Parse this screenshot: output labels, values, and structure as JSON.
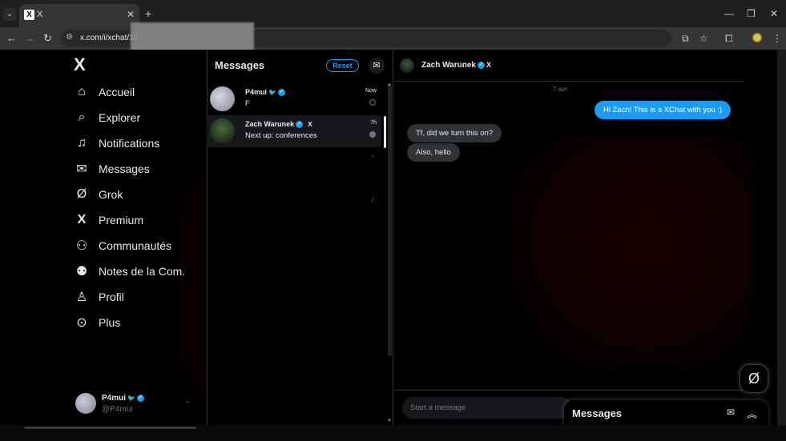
{
  "browser": {
    "tab_title": "X",
    "tab_favicon": "X",
    "url": "x.com/i/xchat/14",
    "menu_icon": "chevron-down-icon",
    "new_tab_icon": "plus-icon"
  },
  "sidebar": {
    "logo": "X",
    "items": [
      {
        "label": "Accueil",
        "icon": "home-icon",
        "glyph": "⌂"
      },
      {
        "label": "Explorer",
        "icon": "search-icon",
        "glyph": "⌕"
      },
      {
        "label": "Notifications",
        "icon": "bell-icon",
        "glyph": "🔔"
      },
      {
        "label": "Messages",
        "icon": "envelope-icon",
        "glyph": "✉"
      },
      {
        "label": "Grok",
        "icon": "grok-icon",
        "glyph": "Ø"
      },
      {
        "label": "Premium",
        "icon": "x-premium-icon",
        "glyph": "X"
      },
      {
        "label": "Communautés",
        "icon": "communities-icon",
        "glyph": "👥"
      },
      {
        "label": "Notes de la Com.",
        "icon": "community-notes-icon",
        "glyph": "👥"
      },
      {
        "label": "Profil",
        "icon": "profile-icon",
        "glyph": "👤"
      },
      {
        "label": "Plus",
        "icon": "more-circle-icon",
        "glyph": "⋯"
      }
    ],
    "account": {
      "name": "P4mui",
      "handle": "@P4mui"
    }
  },
  "messages": {
    "title": "Messages",
    "reset_label": "Reset",
    "conversations": [
      {
        "name": "P4mui",
        "preview": "F",
        "time": "Now",
        "active": false
      },
      {
        "name": "Zach Warunek",
        "preview": "Next up: conferences",
        "time": "7h",
        "active": true
      }
    ]
  },
  "chat": {
    "contact_name": "Zach Warunek",
    "contact_badge": "X",
    "date_separator": "7 avr.",
    "messages": [
      {
        "direction": "out",
        "text": "Hi Zach! This is a XChat with you :)"
      },
      {
        "direction": "in",
        "text": "Tf, did we turn this on?"
      },
      {
        "direction": "in",
        "text": "Also, hello"
      }
    ],
    "composer_placeholder": "Start a message"
  },
  "drawer": {
    "title": "Messages"
  },
  "colors": {
    "accent": "#1d9bf0",
    "background": "#000000",
    "bubble_in": "#2f3336"
  }
}
